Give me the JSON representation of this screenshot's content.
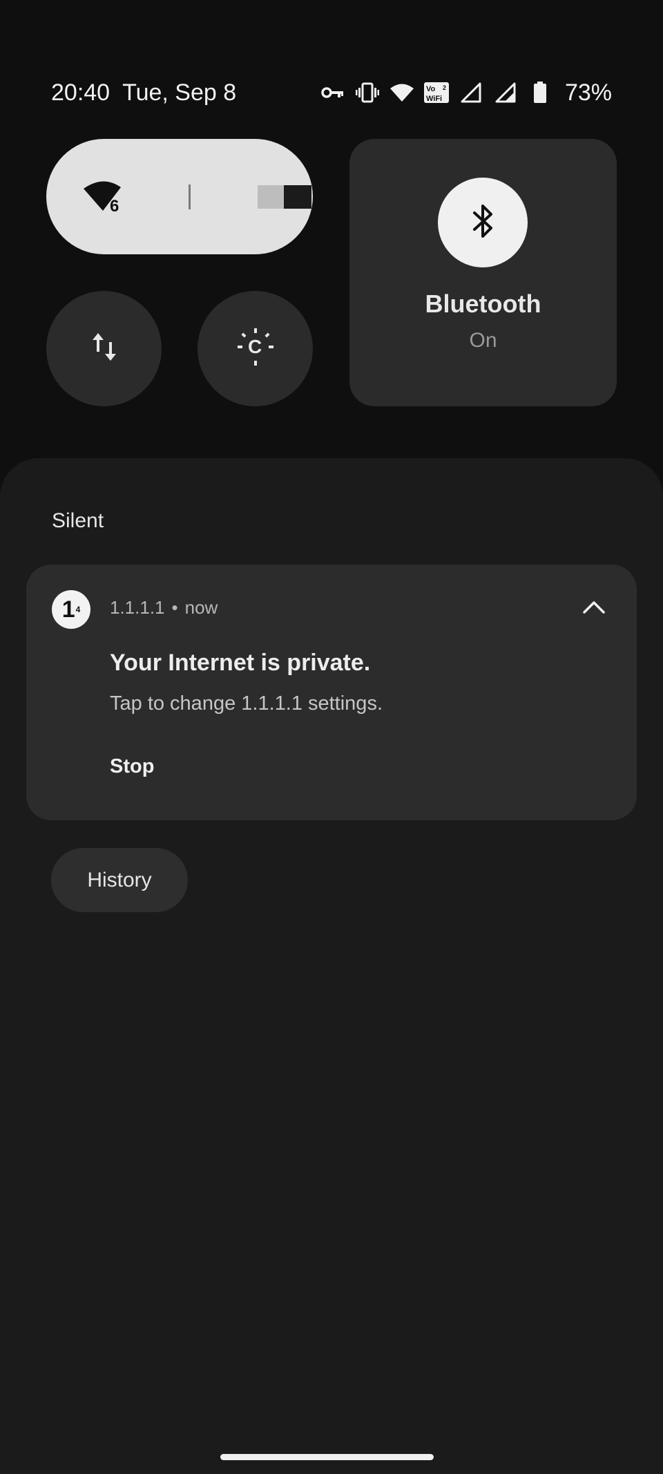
{
  "status_bar": {
    "time": "20:40",
    "date": "Tue, Sep 8",
    "icons": [
      "vpn-key-icon",
      "vibrate-icon",
      "wifi-icon",
      "vowifi-icon",
      "signal-1-icon",
      "signal-2-icon",
      "battery-icon"
    ],
    "vowifi_label": "Vo\nWiFi",
    "battery_percent": "73%"
  },
  "quick_settings": {
    "wifi_tile": {
      "icon": "wifi-6-icon",
      "wifi_version": "6",
      "toggle_state": "on"
    },
    "data_tile": {
      "icon": "mobile-data-icon"
    },
    "cast_tile": {
      "icon": "screen-cast-icon"
    },
    "bluetooth_tile": {
      "icon": "bluetooth-icon",
      "label": "Bluetooth",
      "status": "On"
    }
  },
  "notifications": {
    "section_title": "Silent",
    "items": [
      {
        "app_icon": "app-1111-icon",
        "app_icon_text": "1",
        "app_icon_superscript": "4",
        "app_name": "1.1.1.1",
        "separator": "•",
        "time": "now",
        "title": "Your Internet is private.",
        "text": "Tap to change 1.1.1.1 settings.",
        "action": "Stop"
      }
    ],
    "history_button": "History"
  },
  "colors": {
    "background": "#0f0f0f",
    "shade": "#1b1b1b",
    "card": "#2c2c2c",
    "tile_active": "#e1e1e1",
    "tile_inactive": "#2b2b2b"
  }
}
